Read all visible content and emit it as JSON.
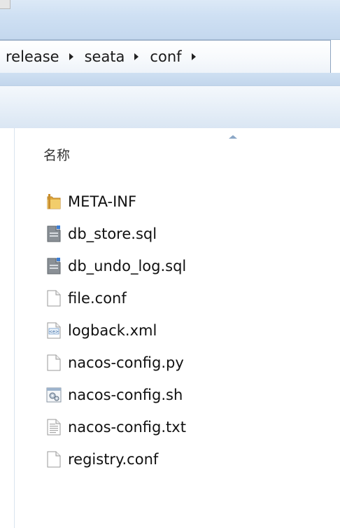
{
  "breadcrumb": {
    "items": [
      "release",
      "seata",
      "conf"
    ]
  },
  "list": {
    "column_name": "名称",
    "sort_direction": "ascending",
    "files": [
      {
        "name": "META-INF",
        "icon": "folder-icon"
      },
      {
        "name": "db_store.sql",
        "icon": "sql-file-icon"
      },
      {
        "name": "db_undo_log.sql",
        "icon": "sql-file-icon"
      },
      {
        "name": "file.conf",
        "icon": "blank-file-icon"
      },
      {
        "name": "logback.xml",
        "icon": "xml-file-icon"
      },
      {
        "name": "nacos-config.py",
        "icon": "blank-file-icon"
      },
      {
        "name": "nacos-config.sh",
        "icon": "script-file-icon"
      },
      {
        "name": "nacos-config.txt",
        "icon": "text-file-icon"
      },
      {
        "name": "registry.conf",
        "icon": "blank-file-icon"
      }
    ]
  },
  "colors": {
    "chrome_blue": "#cfe0f3",
    "border_blue": "#8ea4bf",
    "folder_yellow": "#e8b64a"
  }
}
